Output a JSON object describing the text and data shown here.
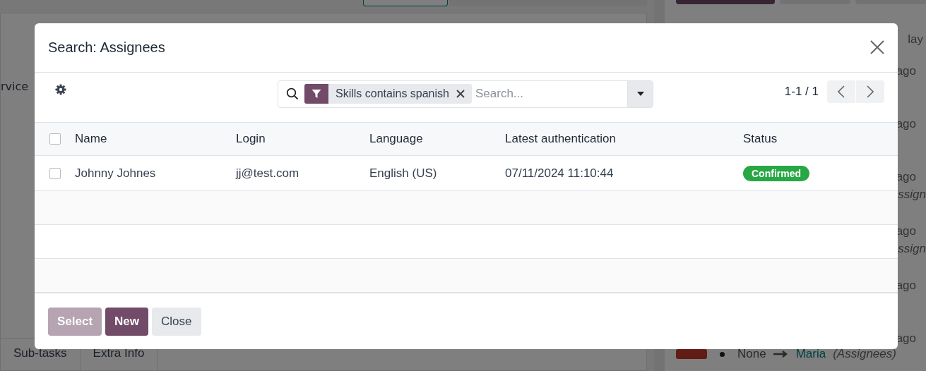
{
  "background": {
    "form_text": "rvice",
    "tabs": [
      {
        "label": "Sub-tasks"
      },
      {
        "label": "Extra Info"
      }
    ],
    "chatter": [
      {
        "kind": "date",
        "text": "lay"
      },
      {
        "kind": "time",
        "text": "ago"
      },
      {
        "kind": "time",
        "text": "ago"
      },
      {
        "kind": "time",
        "text": "ago"
      },
      {
        "kind": "field",
        "text": "ssign"
      },
      {
        "kind": "time",
        "text": "ago"
      },
      {
        "kind": "field",
        "text": "ssign"
      },
      {
        "kind": "time",
        "text": "ago"
      },
      {
        "kind": "time",
        "text": "ago"
      }
    ],
    "last_change": {
      "old": "None",
      "new": "Maria",
      "field": "(Assignees)"
    }
  },
  "dialog": {
    "title": "Search: Assignees",
    "search": {
      "facet": "Skills contains spanish",
      "placeholder": "Search..."
    },
    "pager": "1-1 / 1",
    "table": {
      "header_checked": false,
      "columns": [
        "Name",
        "Login",
        "Language",
        "Latest authentication",
        "Status"
      ],
      "rows": [
        {
          "checked": false,
          "cells": [
            "Johnny Johnes",
            "jj@test.com",
            "English (US)",
            "07/11/2024 11:10:44"
          ],
          "status": {
            "label": "Confirmed",
            "color": "#28a745"
          }
        }
      ]
    },
    "buttons": [
      {
        "kind": "primary",
        "label": "Select",
        "disabled": true
      },
      {
        "kind": "primary",
        "label": "New",
        "disabled": false
      },
      {
        "kind": "secondary",
        "label": "Close",
        "disabled": false
      }
    ]
  }
}
